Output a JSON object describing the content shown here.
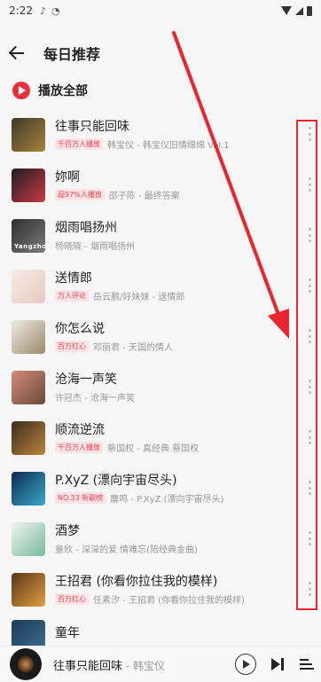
{
  "status_bar": {
    "time": "2:22",
    "icons": [
      "music-note-icon",
      "clock-icon",
      "wifi-icon",
      "signal-icon",
      "battery-icon"
    ]
  },
  "header": {
    "title": "每日推荐",
    "back_icon": "arrow-left-icon"
  },
  "play_all": {
    "label": "播放全部",
    "icon": "play-circle-icon"
  },
  "songs": [
    {
      "title": "往事只能回味",
      "tag": "千百万人播放",
      "artist": "韩宝仪 - 韩宝仪旧情绵绵 Vol.1",
      "cover_colors": [
        "#3d3a2a",
        "#a8823c"
      ]
    },
    {
      "title": "妳啊",
      "tag": "超97%人播放",
      "artist": "邵子陈 - 最终答案",
      "cover_colors": [
        "#1e1e22",
        "#c83844"
      ]
    },
    {
      "title": "烟雨唱扬州",
      "tag": "",
      "artist": "杨晓晓 - 烟雨唱扬州",
      "cover_colors": [
        "#2e2e2e",
        "#7a7a7a"
      ],
      "cover_text": "Yangzhou"
    },
    {
      "title": "送情郎",
      "tag": "万人评论",
      "artist": "岳云鹏/好妹妹 - 送情郎",
      "cover_colors": [
        "#f4ece4",
        "#e9c8c2"
      ]
    },
    {
      "title": "你怎么说",
      "tag": "百万红心",
      "artist": "邓丽君 - 天国的情人",
      "cover_colors": [
        "#ecebe6",
        "#9b8a6a"
      ]
    },
    {
      "title": "沧海一声笑",
      "tag": "",
      "artist": "许冠杰 - 沧海一声笑",
      "cover_colors": [
        "#d68a7a",
        "#6a4a3a"
      ]
    },
    {
      "title": "顺流逆流",
      "tag": "千百万人播放",
      "artist": "蔡国权 - 真经典 蔡国权",
      "cover_colors": [
        "#3e2c1e",
        "#b8843c"
      ]
    },
    {
      "title": "P.XyZ (漂向宇宙尽头)",
      "tag": "NO.33 新歌榜",
      "artist": "麋鸣 - P.XyZ (漂向宇宙尽头)",
      "cover_colors": [
        "#0c2a52",
        "#3aa8c8"
      ]
    },
    {
      "title": "酒梦",
      "tag": "",
      "artist": "童欣 - 深深的爱 情难忘(陪经典金曲)",
      "cover_colors": [
        "#eef4f0",
        "#7ab89a"
      ]
    },
    {
      "title": "王招君 (你看你拉住我的模样)",
      "tag": "百万红心",
      "artist": "任素汐 - 王招君 (你看你拉住我的模样)",
      "cover_colors": [
        "#5a3418",
        "#e0a040"
      ]
    }
  ],
  "partial_song": {
    "title": "童年",
    "cover_colors": [
      "#1e3a5a",
      "#3a6a8a"
    ]
  },
  "player": {
    "title": "往事只能回味",
    "artist": "韩宝仪",
    "separator": " - "
  },
  "annotation": {
    "box_color": "#e8262e",
    "arrow_color": "#e8262e"
  }
}
